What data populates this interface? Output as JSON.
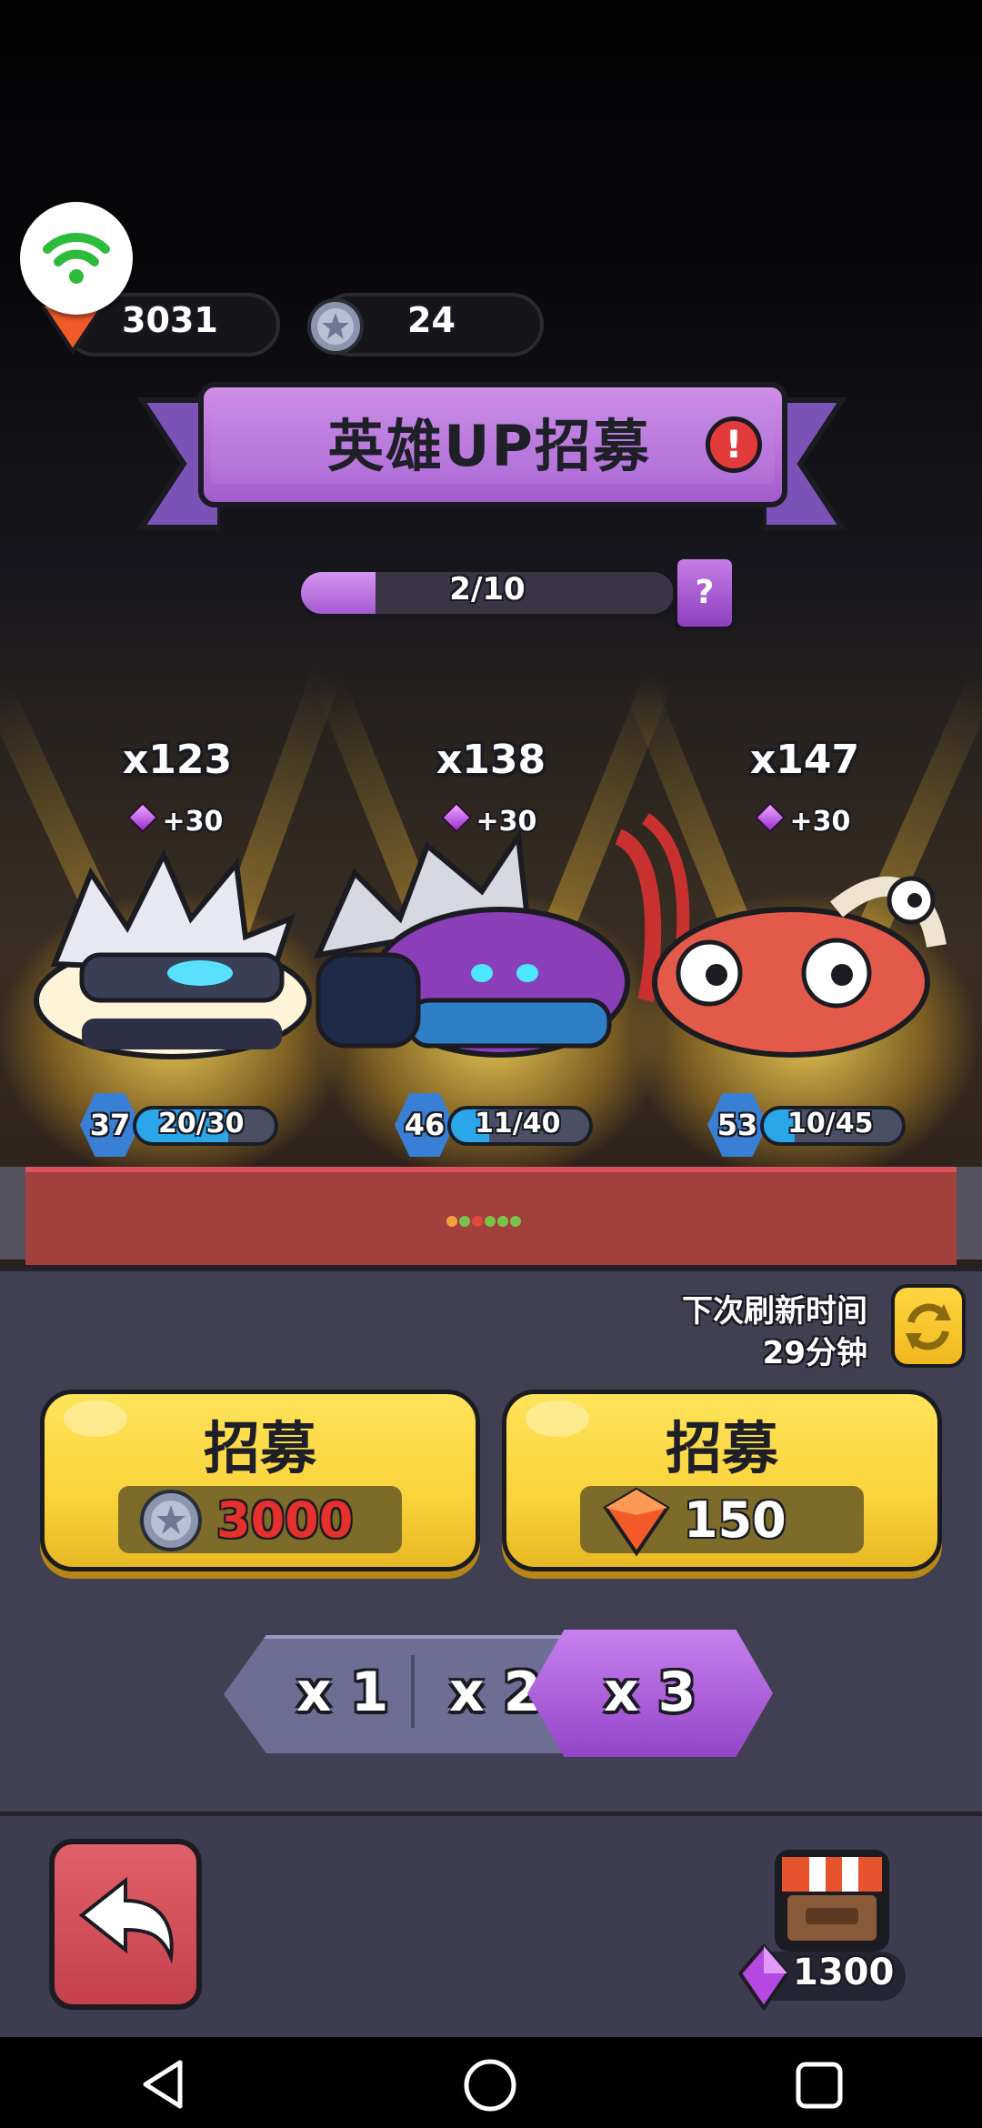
{
  "currencies": {
    "gems": "3031",
    "medals": "24"
  },
  "banner": {
    "title": "英雄UP招募",
    "alert_symbol": "!"
  },
  "progress": {
    "text": "2/10",
    "value": 2,
    "max": 10,
    "help_symbol": "?"
  },
  "heroes": [
    {
      "count": "x123",
      "bonus": "+30",
      "level": "37",
      "shards": "20/30",
      "shard_fraction": 0.667
    },
    {
      "count": "x138",
      "bonus": "+30",
      "level": "46",
      "shards": "11/40",
      "shard_fraction": 0.275
    },
    {
      "count": "x147",
      "bonus": "+30",
      "level": "53",
      "shards": "10/45",
      "shard_fraction": 0.222
    }
  ],
  "refresh": {
    "label": "下次刷新时间",
    "time": "29分钟"
  },
  "recruit_buttons": [
    {
      "label": "招募",
      "price": "3000",
      "currency_icon": "medal-icon",
      "price_color": "#e5302d"
    },
    {
      "label": "招募",
      "price": "150",
      "currency_icon": "gem-icon",
      "price_color": "#ffffff"
    }
  ],
  "multipliers": {
    "options": [
      "x 1",
      "x 2",
      "x 3"
    ],
    "selected": "x 3"
  },
  "shop": {
    "gem_count": "1300"
  },
  "colors": {
    "accent_purple": "#a65ad2",
    "button_yellow": "#fad33a",
    "back_red": "#c4414b"
  }
}
